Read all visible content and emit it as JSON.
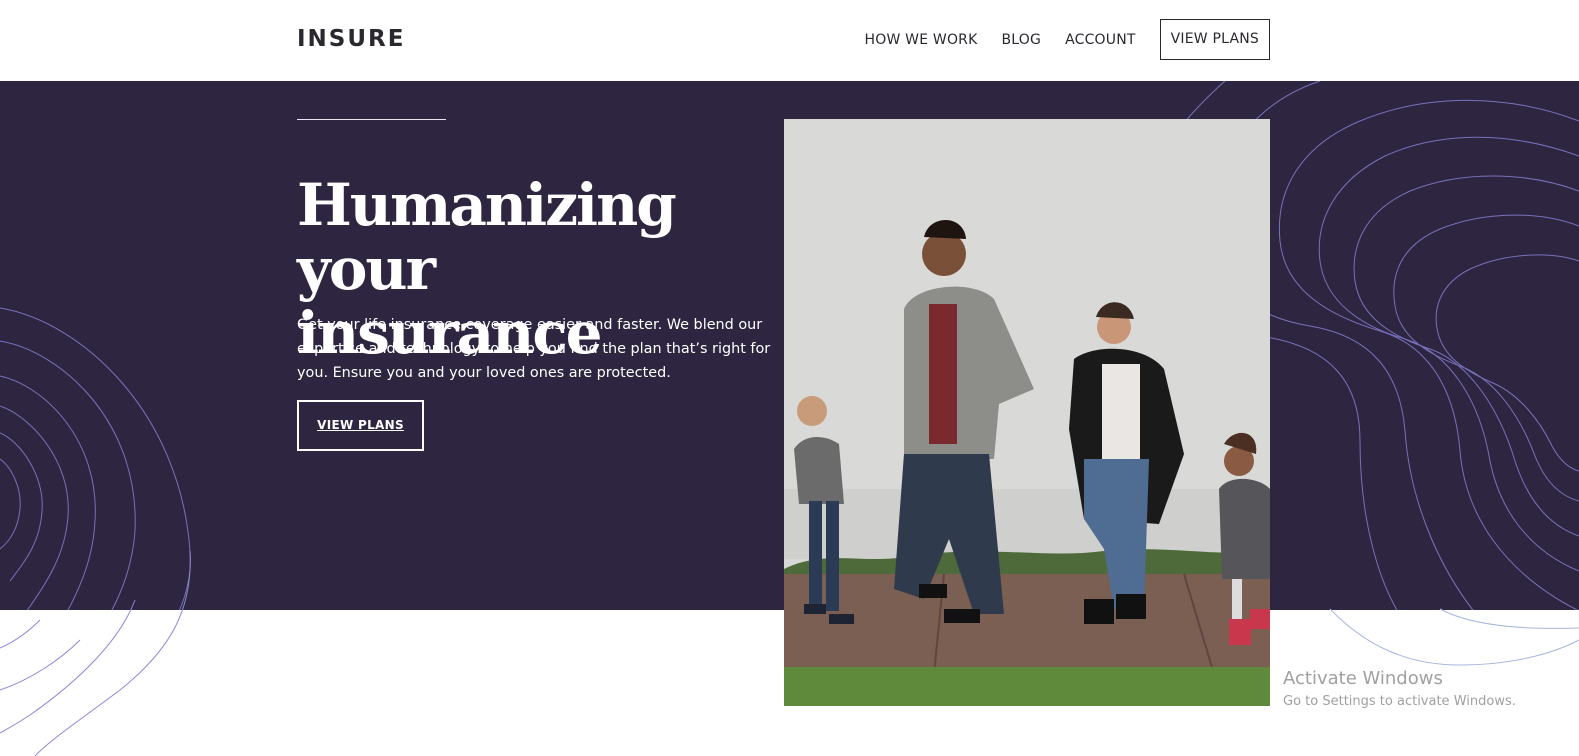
{
  "header": {
    "logo": "INSURE",
    "nav": [
      {
        "label": "HOW WE WORK"
      },
      {
        "label": "BLOG"
      },
      {
        "label": "ACCOUNT"
      }
    ],
    "cta_label": "VIEW PLANS"
  },
  "hero": {
    "title_line1": "Humanizing your",
    "title_line2": "insurance",
    "description": "Get your life insurance coverage easier and faster. We blend our expertise and technology to help you find the plan that’s right for you. Ensure you and your loved ones are protected.",
    "cta_label": "VIEW PLANS"
  },
  "colors": {
    "hero_bg": "#2e2641",
    "contour": "#8d86d6",
    "text_dark": "#2c2830"
  },
  "watermark": {
    "title": "Activate Windows",
    "subtitle": "Go to Settings to activate Windows."
  }
}
